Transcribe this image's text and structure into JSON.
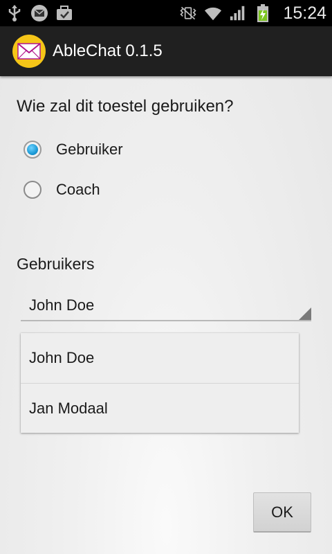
{
  "status_bar": {
    "time": "15:24",
    "icons_left": [
      "usb-icon",
      "mail-icon",
      "briefcase-icon"
    ],
    "icons_right": [
      "vibrate-icon",
      "wifi-icon",
      "signal-icon",
      "battery-charging-icon"
    ]
  },
  "app": {
    "title": "AbleChat 0.1.5",
    "icon": "envelope-icon",
    "brand_color": "#f5c518"
  },
  "question": "Wie zal dit toestel gebruiken?",
  "roles": [
    {
      "label": "Gebruiker",
      "checked": true
    },
    {
      "label": "Coach",
      "checked": false
    }
  ],
  "users_section": {
    "label": "Gebruikers",
    "selected": "John Doe",
    "options": [
      "John Doe",
      "Jan Modaal"
    ]
  },
  "ok_label": "OK",
  "accent_color": "#1b9ad6"
}
